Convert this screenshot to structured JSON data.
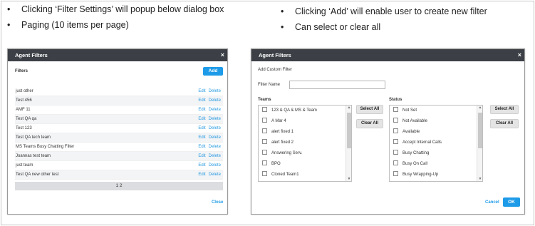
{
  "bullets_left": [
    "Clicking ‘Filter Settings’ will popup below dialog box",
    "Paging (10 items per page)"
  ],
  "bullets_right": [
    "Clicking ‘Add’ will enable user to create new filter",
    "Can select or clear all"
  ],
  "bullet_char": "•",
  "left_dialog": {
    "title": "Agent Filters",
    "close_glyph": "×",
    "filters_label": "Filters",
    "add_label": "Add",
    "edit_label": "Edit",
    "delete_label": "Delete",
    "rows": [
      "just other",
      "Test 456",
      "AMF 11",
      "Test QA qa",
      "Test 123",
      "Test QA tech team",
      "MS Teams Busy Chatting Filter",
      "Joannas test team",
      "just team",
      "Test QA new other test"
    ],
    "pager_text": "1 2",
    "close_label": "Close"
  },
  "right_dialog": {
    "title": "Agent Filters",
    "close_glyph": "×",
    "subtitle": "Add Custom Filter",
    "filter_name_label": "Filter Name",
    "filter_name_value": "",
    "teams_label": "Teams",
    "status_label": "Status",
    "select_all_label": "Select All",
    "clear_all_label": "Clear All",
    "teams": [
      "123 & QA & MS & Team",
      "A Mar 4",
      "alert fixed 1",
      "alert fixed 2",
      "Answering Serv.",
      "BPO",
      "Cloned Team1"
    ],
    "statuses": [
      "Not Set",
      "Not Available",
      "Available",
      "Accept Internal Calls",
      "Busy Chatting",
      "Busy On Call",
      "Busy Wrapping-Up"
    ],
    "cancel_label": "Cancel",
    "ok_label": "OK",
    "scroll_up": "▲",
    "scroll_down": "▼"
  },
  "colors": {
    "header": "#3c4046",
    "accent": "#1e9be8"
  }
}
